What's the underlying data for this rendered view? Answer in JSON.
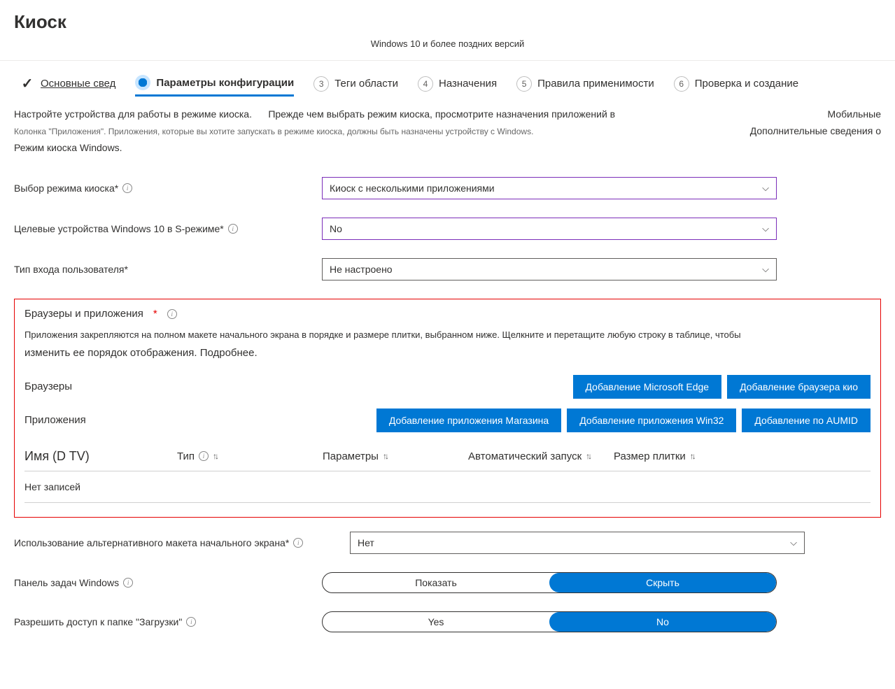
{
  "header": {
    "title": "Киоск",
    "subtitle": "Windows 10 и более поздних версий"
  },
  "stepper": {
    "step1": "Основные свед",
    "step2": "Параметры конфигурации",
    "step3": "Теги области",
    "step3_num": "3",
    "step4": "Назначения",
    "step4_num": "4",
    "step5": "Правила применимости",
    "step5_num": "5",
    "step6": "Проверка и создание",
    "step6_num": "6"
  },
  "intro": {
    "line1a": "Настройте устройства для работы в режиме киоска.",
    "line1b": "Прежде чем выбрать режим киоска, просмотрите назначения приложений в",
    "extra1": "Мобильные",
    "note": "Колонка \"Приложения\". Приложения, которые вы хотите запускать в режиме киоска, должны быть назначены устройству с Windows.",
    "extra2": "Дополнительные сведения о",
    "line3": "Режим киоска Windows."
  },
  "fields": {
    "kiosk_mode": {
      "label": "Выбор режима киоска*",
      "value": "Киоск с несколькими приложениями"
    },
    "s_mode": {
      "label": "Целевые устройства Windows 10 в S-режиме*",
      "value": "No"
    },
    "logon_type": {
      "label": "Тип входа пользователя*",
      "value": "Не настроено"
    },
    "alt_layout": {
      "label": "Использование альтернативного макета начального экрана*",
      "value": "Нет"
    },
    "taskbar": {
      "label": "Панель задач Windows",
      "opt1": "Показать",
      "opt2": "Скрыть"
    },
    "downloads": {
      "label": "Разрешить доступ к папке \"Загрузки\"",
      "opt1": "Yes",
      "opt2": "No"
    }
  },
  "section": {
    "heading": "Браузеры и приложения",
    "desc1": "Приложения закрепляются на полном макете начального экрана в порядке и размере плитки, выбранном ниже. Щелкните и перетащите любую строку в таблице, чтобы",
    "desc2": "изменить ее порядок отображения. Подробнее.",
    "browsers_label": "Браузеры",
    "apps_label": "Приложения",
    "btn_edge": "Добавление Microsoft Edge",
    "btn_kiosk_browser": "Добавление браузера кио",
    "btn_store": "Добавление приложения Магазина",
    "btn_win32": "Добавление приложения Win32",
    "btn_aumid": "Добавление по AUMID",
    "col_name": "Имя (D TV)",
    "col_type": "Тип",
    "col_params": "Параметры",
    "col_autolaunch": "Автоматический запуск",
    "col_tilesize": "Размер плитки",
    "no_records": "Нет записей"
  }
}
